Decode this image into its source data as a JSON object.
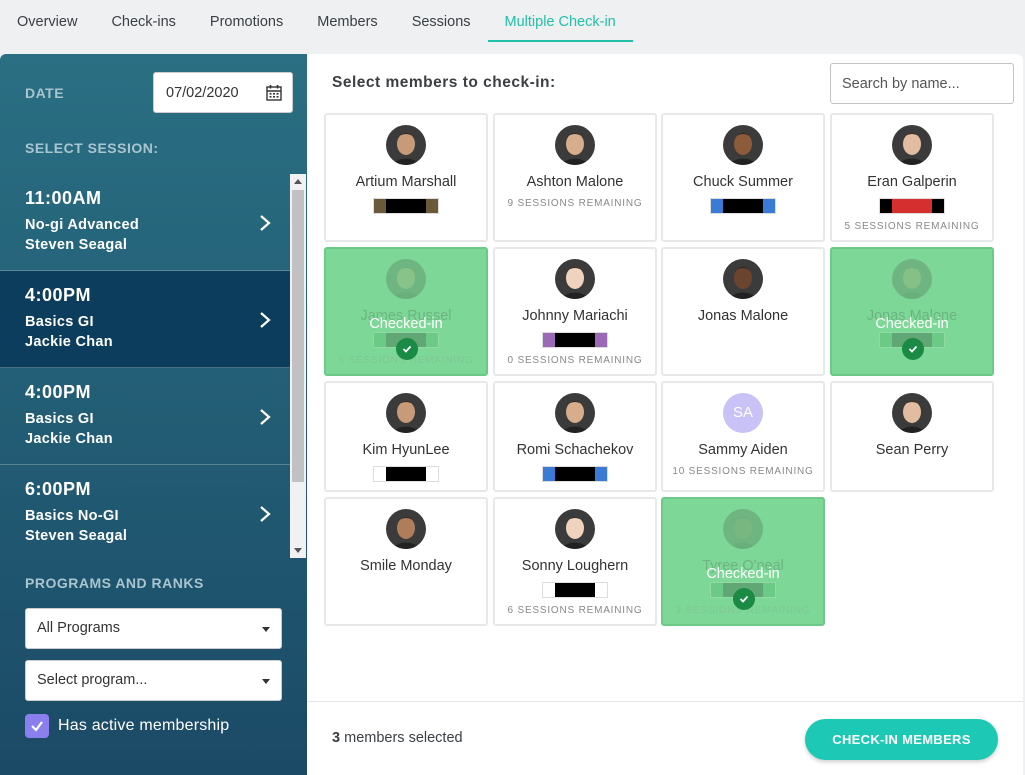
{
  "tabs": [
    "Overview",
    "Check-ins",
    "Promotions",
    "Members",
    "Sessions",
    "Multiple Check-in"
  ],
  "active_tab": "Multiple Check-in",
  "sidebar": {
    "date_label": "DATE",
    "date_value": "07/02/2020",
    "session_label": "SELECT SESSION:",
    "sessions": [
      {
        "time": "11:00AM",
        "name": "No-gi Advanced",
        "coach": "Steven Seagal",
        "selected": false
      },
      {
        "time": "4:00PM",
        "name": "Basics GI",
        "coach": "Jackie Chan",
        "selected": true
      },
      {
        "time": "4:00PM",
        "name": "Basics GI",
        "coach": "Jackie Chan",
        "selected": false
      },
      {
        "time": "6:00PM",
        "name": "Basics No-GI",
        "coach": "Steven Seagal",
        "selected": false
      }
    ],
    "programs_label": "PROGRAMS AND RANKS",
    "program_select": "All Programs",
    "program_placeholder": "Select program...",
    "active_membership_label": "Has active membership",
    "active_membership_checked": true
  },
  "main": {
    "title": "Select members to check-in:",
    "search_placeholder": "Search by name...",
    "checked_in_label": "Checked-in",
    "members": [
      {
        "name": "Artium Marshall",
        "avatar": "photo",
        "belt": [
          "#6b5a3a",
          "#000000",
          "#6b5a3a"
        ],
        "remaining": "",
        "checked": false
      },
      {
        "name": "Ashton Malone",
        "avatar": "photo",
        "belt": [],
        "remaining": "9 SESSIONS REMAINING",
        "checked": false
      },
      {
        "name": "Chuck Summer",
        "avatar": "photo",
        "belt": [
          "#3a7bd5",
          "#000000",
          "#3a7bd5"
        ],
        "remaining": "",
        "checked": false
      },
      {
        "name": "Eran Galperin",
        "avatar": "photo",
        "belt": [
          "#000000",
          "#d62f2f",
          "#000000"
        ],
        "remaining": "5 SESSIONS REMAINING",
        "checked": false
      },
      {
        "name": "James Russel",
        "avatar": "photo",
        "belt": [
          "#2f9a4c",
          "#000000",
          "#2f9a4c"
        ],
        "remaining": "6 SESSIONS REMAINING",
        "checked": true
      },
      {
        "name": "Johnny Mariachi",
        "avatar": "photo",
        "belt": [
          "#9b69b8",
          "#000000",
          "#9b69b8"
        ],
        "remaining": "0 SESSIONS REMAINING",
        "checked": false
      },
      {
        "name": "Jonas Malone",
        "avatar": "photo",
        "belt": [],
        "remaining": "",
        "checked": false
      },
      {
        "name": "Jonas Malone",
        "avatar": "photo",
        "belt": [
          "#2f9a4c",
          "#000000",
          "#2f9a4c"
        ],
        "remaining": "",
        "checked": true
      },
      {
        "name": "Kim HyunLee",
        "avatar": "photo",
        "belt": [
          "#ffffff",
          "#000000",
          "#ffffff"
        ],
        "remaining": "",
        "checked": false
      },
      {
        "name": "Romi Schachekov",
        "avatar": "photo",
        "belt": [
          "#3a7bd5",
          "#000000",
          "#3a7bd5"
        ],
        "remaining": "",
        "checked": false
      },
      {
        "name": "Sammy Aiden",
        "avatar": "SA",
        "belt": [],
        "remaining": "10 SESSIONS REMAINING",
        "checked": false
      },
      {
        "name": "Sean Perry",
        "avatar": "photo",
        "belt": [],
        "remaining": "",
        "checked": false
      },
      {
        "name": "Smile Monday",
        "avatar": "photo",
        "belt": [],
        "remaining": "",
        "checked": false
      },
      {
        "name": "Sonny Loughern",
        "avatar": "photo",
        "belt": [
          "#ffffff",
          "#000000",
          "#ffffff"
        ],
        "remaining": "6 SESSIONS REMAINING",
        "checked": false
      },
      {
        "name": "Tyree O'neal",
        "avatar": "photo",
        "belt": [
          "#2f9a4c",
          "#000000",
          "#2f9a4c"
        ],
        "remaining": "3 SESSIONS REMAINING",
        "checked": true
      }
    ]
  },
  "footer": {
    "selected_count": "3",
    "selected_text": "members selected",
    "checkin_button": "CHECK-IN MEMBERS"
  },
  "colors": {
    "accent": "#21c0a8",
    "checked_bg": "#7dd897",
    "button": "#1dc9b4"
  }
}
